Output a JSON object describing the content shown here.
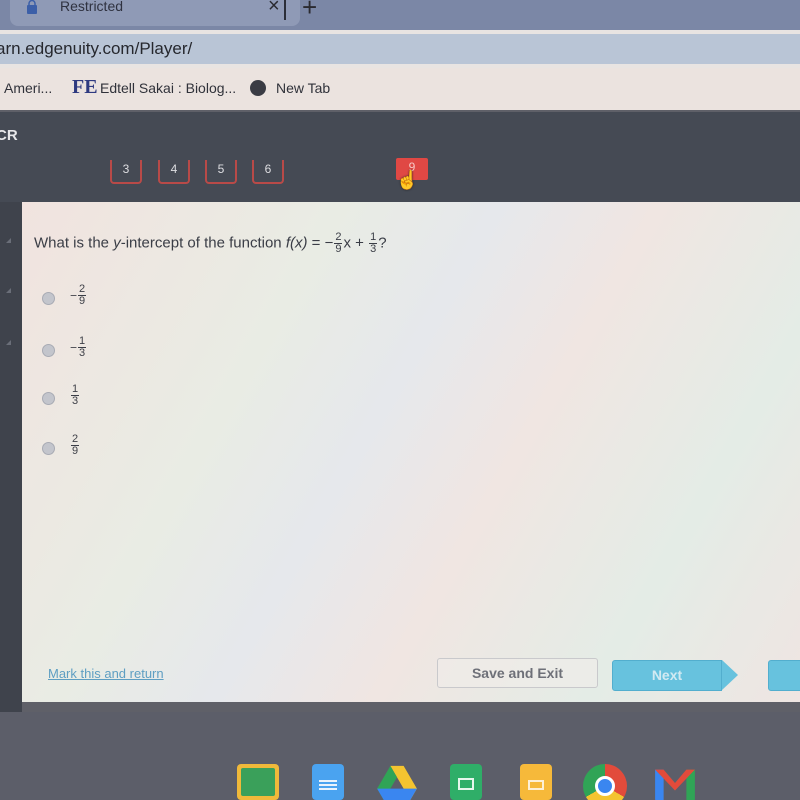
{
  "browser": {
    "tab": {
      "title": "Restricted",
      "icon": "lock-icon",
      "close_glyph": "×"
    },
    "new_tab_glyph": "+",
    "url": "arn.edgenuity.com/Player/",
    "bookmarks": [
      {
        "label": "Ameri...",
        "icon": ""
      },
      {
        "label": "Edtell Sakai : Biolog...",
        "icon": "FE"
      },
      {
        "label": "New Tab",
        "icon": "globe-icon"
      }
    ]
  },
  "app": {
    "abbr": "CR",
    "question_nav": [
      {
        "label": "3",
        "active": false
      },
      {
        "label": "4",
        "active": false
      },
      {
        "label": "5",
        "active": false
      },
      {
        "label": "6",
        "active": false
      },
      {
        "label": "9",
        "active": true
      }
    ],
    "accent_color": "#e04844"
  },
  "question": {
    "prefix": "What is the ",
    "var": "y",
    "middle": "-intercept of the function ",
    "func": "f(x)",
    "equals": " = −",
    "frac1": {
      "num": "2",
      "den": "9"
    },
    "x_plus": "x + ",
    "frac2": {
      "num": "1",
      "den": "3"
    },
    "suffix": "?"
  },
  "options": [
    {
      "sign": "−",
      "num": "2",
      "den": "9",
      "selected": false
    },
    {
      "sign": "−",
      "num": "1",
      "den": "3",
      "selected": false
    },
    {
      "sign": "",
      "num": "1",
      "den": "3",
      "selected": false
    },
    {
      "sign": "",
      "num": "2",
      "den": "9",
      "selected": false
    }
  ],
  "footer": {
    "mark_link": "Mark this and return",
    "save_exit": "Save and Exit",
    "next": "Next"
  },
  "shelf": [
    "google-classroom-icon",
    "google-docs-icon",
    "google-drive-icon",
    "google-sheets-icon",
    "google-slides-icon",
    "chrome-icon",
    "gmail-icon"
  ]
}
